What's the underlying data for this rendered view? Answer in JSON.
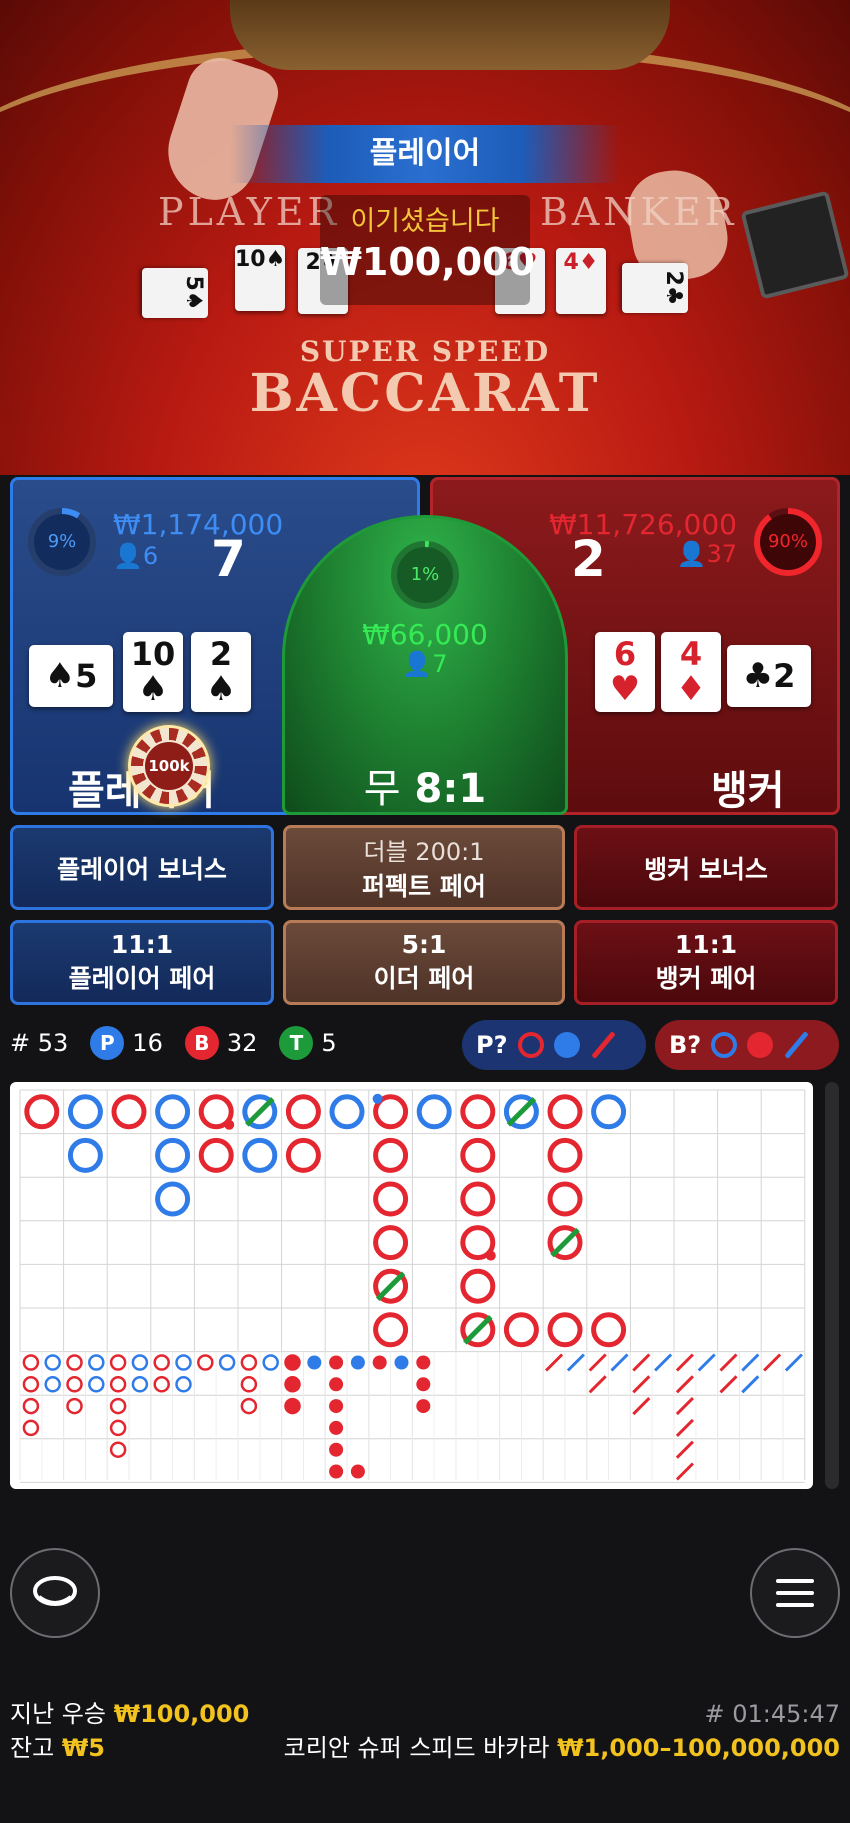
{
  "video": {
    "banner": "플레이어",
    "table_player": "PLAYER",
    "table_banker": "BANKER",
    "win_message": "이기셨습니다",
    "win_amount": "₩100,000",
    "logo_line1": "SUPER SPEED",
    "logo_line2": "BACCARAT"
  },
  "player": {
    "percent": "9%",
    "percent_value": 9,
    "amount": "₩1,174,000",
    "users": "6",
    "score": "7",
    "label": "플레이어",
    "cards": [
      {
        "rank": "5",
        "suit": "♠",
        "color": "black",
        "sideways": true
      },
      {
        "rank": "10",
        "suit": "♠",
        "color": "black",
        "sideways": false
      },
      {
        "rank": "2",
        "suit": "♠",
        "color": "black",
        "sideways": false
      }
    ],
    "chip": "100k"
  },
  "tie": {
    "percent": "1%",
    "percent_value": 1,
    "amount": "₩66,000",
    "users": "7",
    "label": "무",
    "payout": "8:1"
  },
  "banker": {
    "percent": "90%",
    "percent_value": 90,
    "amount": "₩11,726,000",
    "users": "37",
    "score": "2",
    "label": "뱅커",
    "cards": [
      {
        "rank": "6",
        "suit": "♥",
        "color": "red",
        "sideways": false
      },
      {
        "rank": "4",
        "suit": "♦",
        "color": "red",
        "sideways": false
      },
      {
        "rank": "2",
        "suit": "♣",
        "color": "black",
        "sideways": true
      }
    ]
  },
  "side_bets": {
    "player_bonus": "플레이어 보너스",
    "perfect_pair_payout": "더블 200:1",
    "perfect_pair": "퍼펙트 페어",
    "banker_bonus": "뱅커 보너스",
    "player_pair_payout": "11:1",
    "player_pair": "플레이어 페어",
    "either_pair_payout": "5:1",
    "either_pair": "이더 페어",
    "banker_pair_payout": "11:1",
    "banker_pair": "뱅커 페어"
  },
  "stats": {
    "round_label": "#",
    "round": "53",
    "p_badge": "P",
    "p_count": "16",
    "b_badge": "B",
    "b_count": "32",
    "t_badge": "T",
    "t_count": "5",
    "p_predict": "P?",
    "b_predict": "B?"
  },
  "colors": {
    "player": "#2f7be8",
    "banker": "#e3262f",
    "tie": "#1d9a3a",
    "gold": "#f2c21e"
  },
  "roadmap": {
    "big_road": [
      [
        "B"
      ],
      [
        "P",
        "P"
      ],
      [
        "B"
      ],
      [
        "P",
        "P",
        "P"
      ],
      [
        "B",
        "B"
      ],
      [
        "P",
        "P"
      ],
      [
        "B",
        "B"
      ],
      [
        "P"
      ],
      [
        "B",
        "B",
        "B",
        "B",
        "B",
        "B"
      ],
      [
        "P"
      ],
      [
        "B",
        "B",
        "B",
        "B",
        "B",
        "B"
      ],
      [
        "P"
      ],
      [
        "B",
        "B",
        "B",
        "B"
      ],
      [
        "P"
      ]
    ],
    "big_road_tail": [
      "B",
      "B",
      "B"
    ],
    "big_road_marks": [
      {
        "col": 4,
        "row": 0,
        "mark": "banker-pair"
      },
      {
        "col": 5,
        "row": 0,
        "mark": "tie"
      },
      {
        "col": 8,
        "row": 0,
        "mark": "player-pair"
      },
      {
        "col": 11,
        "row": 0,
        "mark": "tie"
      },
      {
        "col": 10,
        "row": 3,
        "mark": "banker-pair"
      },
      {
        "col": 12,
        "row": 3,
        "mark": "tie"
      },
      {
        "col": 8,
        "row": 4,
        "mark": "tie"
      },
      {
        "col": 10,
        "row": 5,
        "mark": "tie"
      }
    ],
    "big_eye": [
      [
        "B",
        "B",
        "B",
        "B"
      ],
      [
        "P",
        "P"
      ],
      [
        "B",
        "B",
        "B"
      ],
      [
        "P",
        "P"
      ],
      [
        "B",
        "B",
        "B",
        "B",
        "B"
      ],
      [
        "P",
        "P"
      ],
      [
        "B",
        "B"
      ],
      [
        "P",
        "P"
      ],
      [
        "B"
      ],
      [
        "P"
      ],
      [
        "B",
        "B",
        "B"
      ],
      [
        "P"
      ],
      [
        "B",
        "B",
        "B"
      ]
    ],
    "small_road": [
      [
        "B",
        "B",
        "B"
      ],
      [
        "P"
      ],
      [
        "B",
        "B",
        "B",
        "B",
        "B",
        "B",
        "B"
      ],
      [
        "P"
      ],
      [
        "B"
      ],
      [
        "P"
      ],
      [
        "B",
        "B",
        "B"
      ]
    ],
    "cockroach": [
      [
        "B"
      ],
      [
        "P"
      ],
      [
        "B",
        "B"
      ],
      [
        "P"
      ],
      [
        "B",
        "B",
        "B"
      ],
      [
        "P"
      ],
      [
        "B",
        "B",
        "B",
        "B",
        "B",
        "B"
      ],
      [
        "P"
      ],
      [
        "B",
        "B"
      ],
      [
        "P",
        "P"
      ],
      [
        "B"
      ],
      [
        "P"
      ]
    ]
  },
  "footer": {
    "last_win_label": "지난 우승",
    "last_win": "₩100,000",
    "balance_label": "잔고",
    "balance": "₩5",
    "game_id": "# 01:45:47",
    "table_name": "코리안 슈퍼 스피드 바카라",
    "limits": "₩1,000–100,000,000"
  }
}
